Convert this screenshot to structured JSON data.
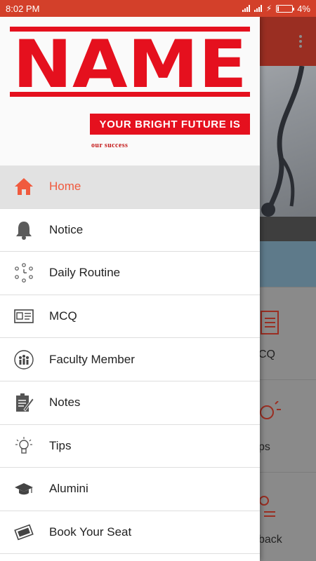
{
  "status_bar": {
    "time": "8:02 PM",
    "battery": "4%",
    "battery_level": 0.04
  },
  "drawer": {
    "brand": {
      "logo_text": "NAME",
      "tagline": "YOUR BRIGHT FUTURE IS",
      "subtitle": "our success"
    },
    "items": [
      {
        "label": "Home",
        "icon": "home-icon",
        "active": true
      },
      {
        "label": "Notice",
        "icon": "bell-icon",
        "active": false
      },
      {
        "label": "Daily Routine",
        "icon": "routine-clock-icon",
        "active": false
      },
      {
        "label": "MCQ",
        "icon": "id-card-icon",
        "active": false
      },
      {
        "label": "Faculty Member",
        "icon": "group-icon",
        "active": false
      },
      {
        "label": "Notes",
        "icon": "notes-icon",
        "active": false
      },
      {
        "label": "Tips",
        "icon": "bulb-icon",
        "active": false
      },
      {
        "label": "Alumini",
        "icon": "graduation-cap-icon",
        "active": false
      },
      {
        "label": "Book Your Seat",
        "icon": "book-seat-icon",
        "active": false
      }
    ]
  },
  "background": {
    "tiles": [
      {
        "label": "CQ"
      },
      {
        "label": "ps"
      },
      {
        "label": "back"
      }
    ]
  },
  "colors": {
    "status_bar": "#d3402a",
    "brand_red": "#e5101e",
    "active_accent": "#f05a3e"
  }
}
